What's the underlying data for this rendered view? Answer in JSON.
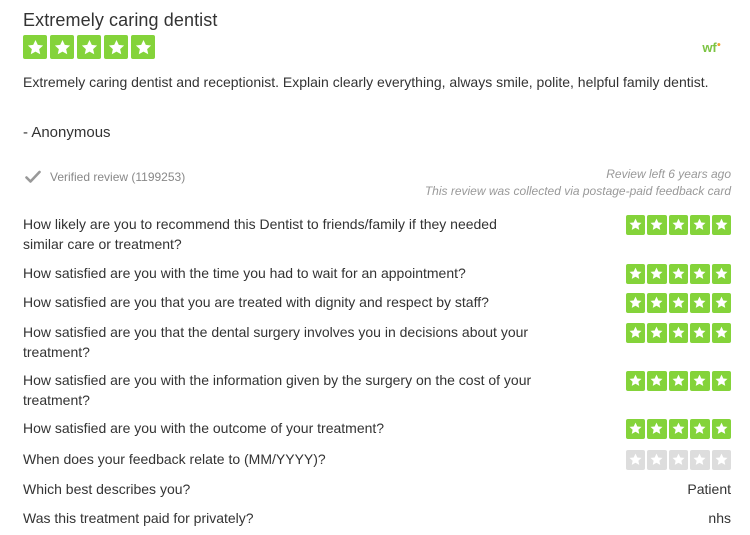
{
  "review": {
    "title": "Extremely caring dentist",
    "rating": 5,
    "body": "Extremely caring dentist and receptionist. Explain clearly everything, always smile, polite, helpful family dentist.",
    "author": "- Anonymous",
    "logo_text": "wf",
    "logo_icon": "wf-logo-icon",
    "verified_text": "Verified review (1199253)",
    "review_age": "Review left 6 years ago",
    "collection_note": "This review was collected via postage-paid feedback card"
  },
  "colors": {
    "star_on": "#84d33a",
    "star_off": "#dddddd",
    "logo": "#7cc443"
  },
  "questions": [
    {
      "text": "How likely are you to recommend this Dentist to friends/family if they needed similar care or treatment?",
      "rating": 5
    },
    {
      "text": "How satisfied are you with the time you had to wait for an appointment?",
      "rating": 5
    },
    {
      "text": "How satisfied are you that you are treated with dignity and respect by staff?",
      "rating": 5
    },
    {
      "text": "How satisfied are you that the dental surgery involves you in decisions about your treatment?",
      "rating": 5
    },
    {
      "text": "How satisfied are you with the information given by the surgery on the cost of your treatment?",
      "rating": 5
    },
    {
      "text": "How satisfied are you with the outcome of your treatment?",
      "rating": 5
    },
    {
      "text": "When does your feedback relate to (MM/YYYY)?",
      "rating": 0
    },
    {
      "text": "Which best describes you?",
      "value": "Patient"
    },
    {
      "text": "Was this treatment paid for privately?",
      "value": "nhs"
    }
  ]
}
